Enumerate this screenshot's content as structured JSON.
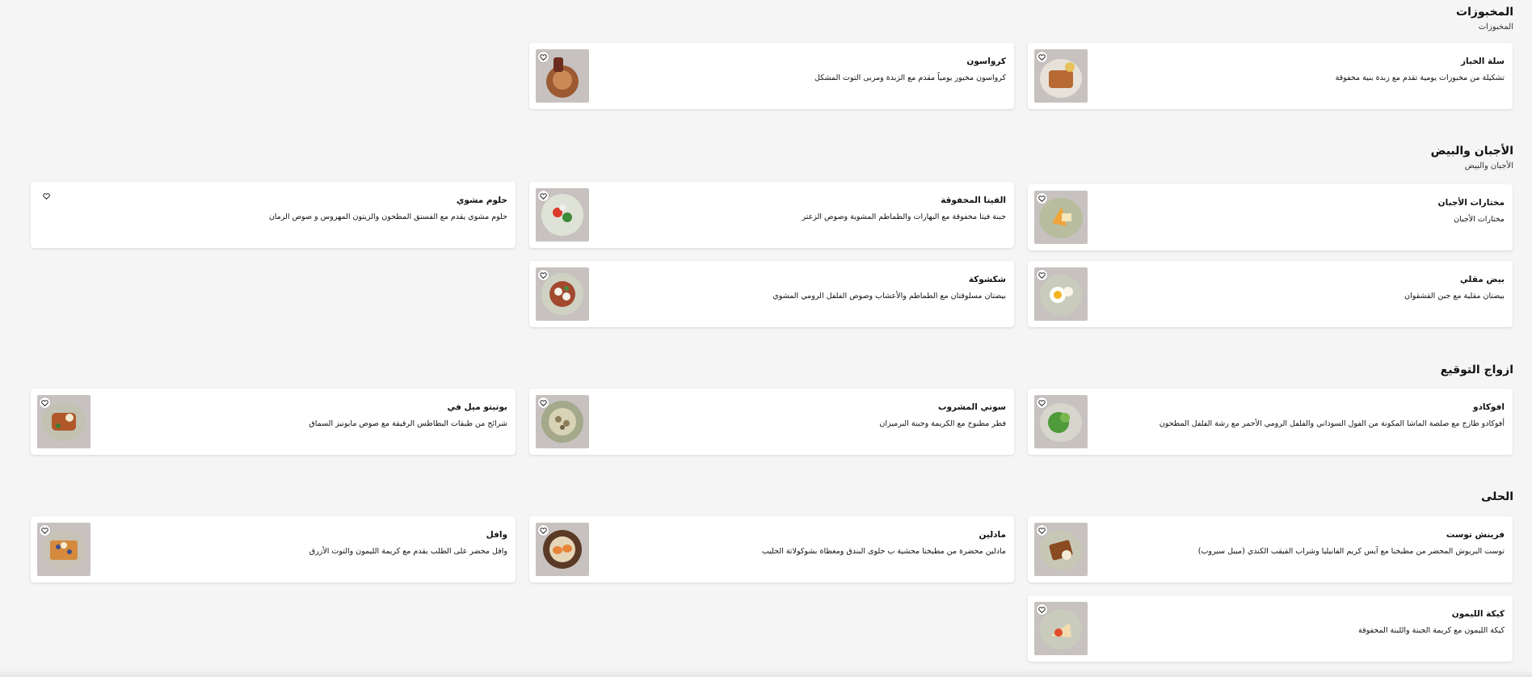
{
  "sections": [
    {
      "title": "المخبوزات",
      "subtitle": "المخبوزات"
    },
    {
      "title": "الأجبان والبيض",
      "subtitle": "الأجبان والبيض"
    },
    {
      "title": "ازواج التوقيع",
      "subtitle": ""
    },
    {
      "title": "الحلى",
      "subtitle": ""
    }
  ],
  "items": [
    {
      "name": "سلة الخباز",
      "description": "تشكيلة من مخبوزات يومية تقدم مع زبدة بنية مخفوقة",
      "icon": "heart-icon"
    },
    {
      "name": "كرواسون",
      "description": "كرواسون مخبوز يومياً مقدم مع الزبدة ومربى التوت المشكل",
      "icon": "heart-icon"
    },
    {
      "name": "مختارات الأجبان",
      "description": "مختارات الأجبان",
      "icon": "heart-icon"
    },
    {
      "name": "الفيتا المخفوقة",
      "description": "جبنة فيتا مخفوقة مع البهارات والطماطم المشوية وصوص الزعتر",
      "icon": "heart-icon"
    },
    {
      "name": "حلوم مشوي",
      "description": "حلوم مشوي يقدم مع الفستق المطحون والزيتون المهروس و صوص الرمان",
      "icon": "heart-icon"
    },
    {
      "name": "بيض مقلي",
      "description": "بيضتان مقلية مع جبن القشقوان",
      "icon": "heart-icon"
    },
    {
      "name": "شكشوكة",
      "description": "بيضتان مسلوقتان مع الطماطم والأعشاب وصوص الفلفل الرومي المشوي",
      "icon": "heart-icon"
    },
    {
      "name": "افوكادو",
      "description": "أفوكادو طازج مع صلصة الماشا المكونة من الفول السوداني والفلفل الرومي الأحمر مع رشة الفلفل المطحون",
      "icon": "heart-icon"
    },
    {
      "name": "سوتي المشروب",
      "description": "فطر مطبوخ مع الكريمة وجبنة البرميزان",
      "icon": "heart-icon"
    },
    {
      "name": "بوتيتو ميل في",
      "description": "شرائح من طبقات البطاطس الرقيقة مع صوص مايونيز السماق",
      "icon": "heart-icon"
    },
    {
      "name": "فرينش توست",
      "description": "توست البريوش المحضر من مطبخنا مع آيس كريم الفانيليا وشراب القيقب الكندي (ميبل سيروب)",
      "icon": "heart-icon"
    },
    {
      "name": "مادلين",
      "description": "مادلين محضرة من مطبخنا محشية ب حلوى البندق ومغطاة بشوكولاتة الحليب",
      "icon": "heart-icon"
    },
    {
      "name": "وافل",
      "description": "وافل محضر على الطلب يقدم مع كريمة الليمون والتوت الأزرق",
      "icon": "heart-icon"
    },
    {
      "name": "كيكة الليمون",
      "description": "كيكة الليمون مع كريمة الجبنة واللبنة المخفوقة",
      "icon": "heart-icon"
    }
  ]
}
